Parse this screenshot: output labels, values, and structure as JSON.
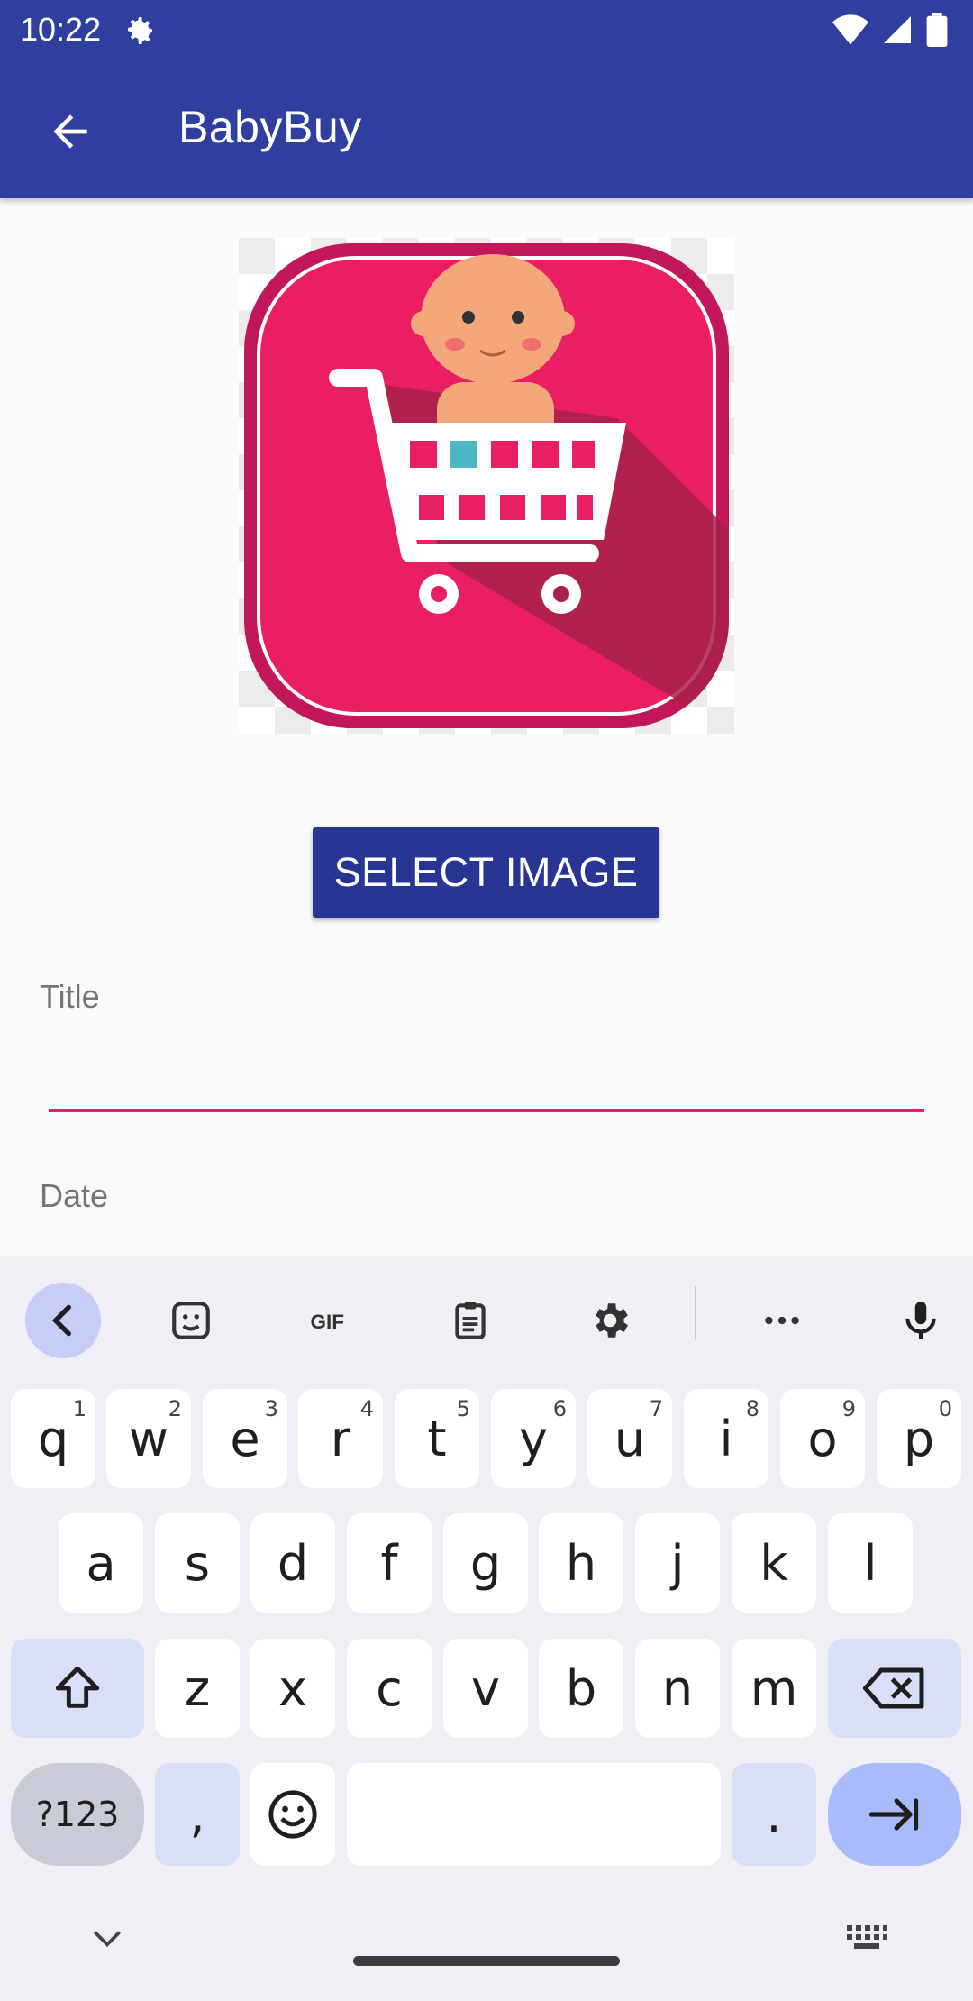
{
  "status_bar": {
    "time": "10:22"
  },
  "app_bar": {
    "title": "BabyBuy"
  },
  "main": {
    "select_image_label": "SELECT IMAGE",
    "title_label": "Title",
    "date_label": "Date"
  },
  "colors": {
    "primary": "#303f9f",
    "button": "#283593",
    "accent": "#e91e63",
    "logo_pink": "#e91e63"
  },
  "keyboard": {
    "row1": [
      {
        "key": "q",
        "hint": "1"
      },
      {
        "key": "w",
        "hint": "2"
      },
      {
        "key": "e",
        "hint": "3"
      },
      {
        "key": "r",
        "hint": "4"
      },
      {
        "key": "t",
        "hint": "5"
      },
      {
        "key": "y",
        "hint": "6"
      },
      {
        "key": "u",
        "hint": "7"
      },
      {
        "key": "i",
        "hint": "8"
      },
      {
        "key": "o",
        "hint": "9"
      },
      {
        "key": "p",
        "hint": "0"
      }
    ],
    "row2": [
      "a",
      "s",
      "d",
      "f",
      "g",
      "h",
      "j",
      "k",
      "l"
    ],
    "row3": [
      "z",
      "x",
      "c",
      "v",
      "b",
      "n",
      "m"
    ],
    "symbols_label": "?123",
    "comma": ",",
    "period": ".",
    "toolbar_icons": [
      "back-chevron-icon",
      "sticker-icon",
      "gif-icon",
      "clipboard-icon",
      "settings-icon",
      "more-icon",
      "microphone-icon"
    ]
  }
}
